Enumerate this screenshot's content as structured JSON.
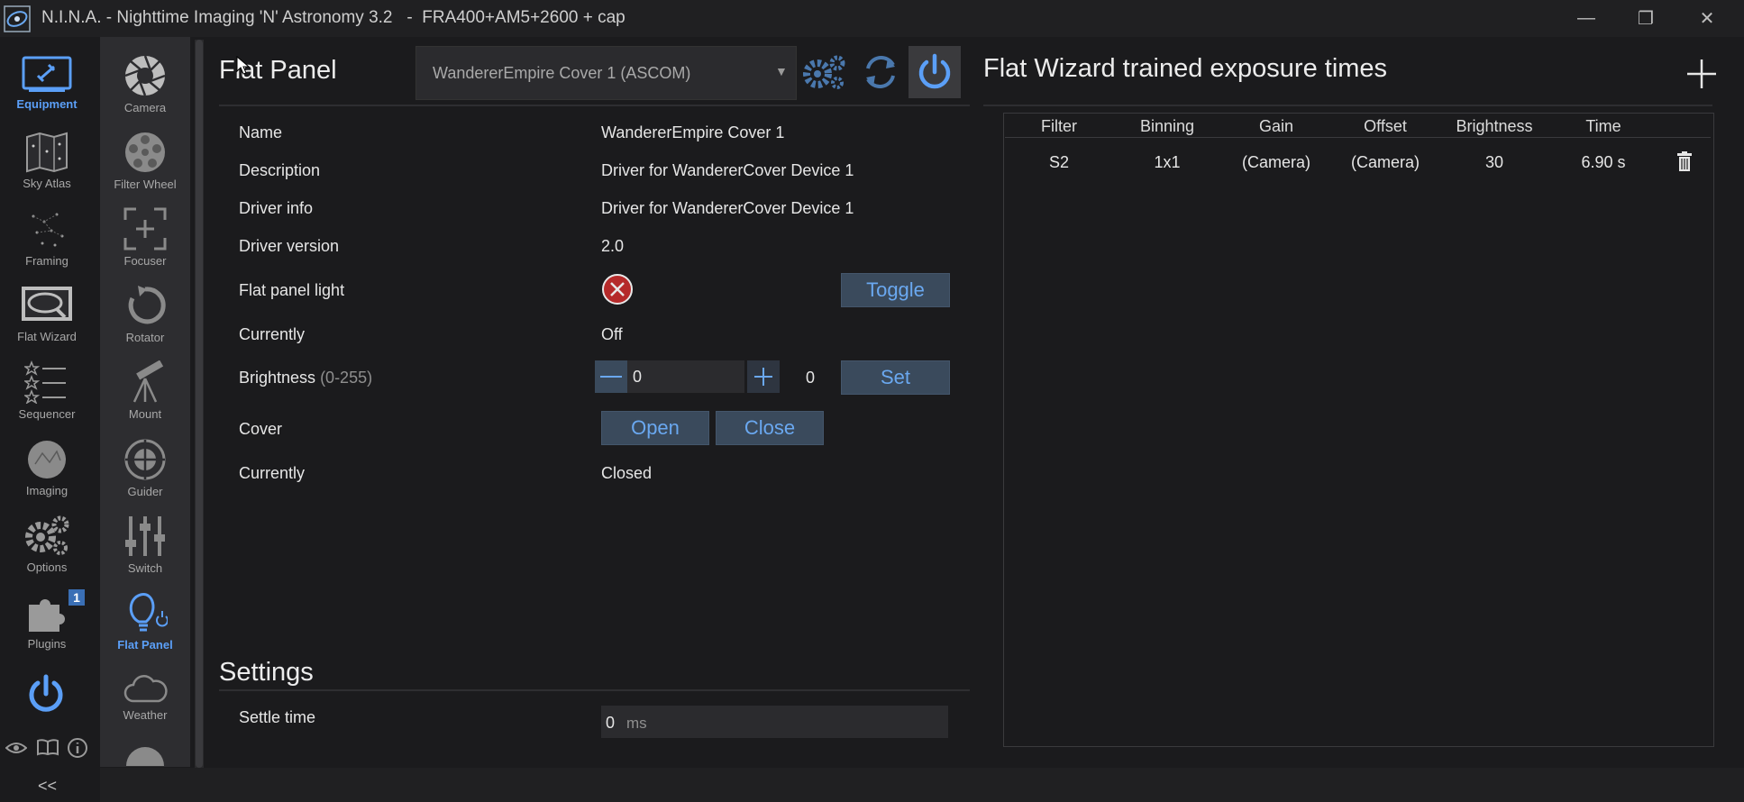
{
  "window": {
    "title": "N.I.N.A. - Nighttime Imaging 'N' Astronomy 3.2   -  FRA400+AM5+2600 + cap",
    "minimize": "—",
    "maximize": "❐",
    "close": "✕"
  },
  "nav_primary": [
    {
      "label": "Equipment",
      "icon": "equipment-icon",
      "active": true
    },
    {
      "label": "Sky Atlas",
      "icon": "sky-atlas-icon"
    },
    {
      "label": "Framing",
      "icon": "framing-icon"
    },
    {
      "label": "Flat Wizard",
      "icon": "flat-wizard-icon"
    },
    {
      "label": "Sequencer",
      "icon": "sequencer-icon"
    },
    {
      "label": "Imaging",
      "icon": "imaging-icon"
    },
    {
      "label": "Options",
      "icon": "options-icon"
    },
    {
      "label": "Plugins",
      "icon": "plugins-icon",
      "badge": "1"
    }
  ],
  "nav_secondary": [
    {
      "label": "Camera",
      "icon": "camera-icon"
    },
    {
      "label": "Filter Wheel",
      "icon": "filter-wheel-icon"
    },
    {
      "label": "Focuser",
      "icon": "focuser-icon"
    },
    {
      "label": "Rotator",
      "icon": "rotator-icon"
    },
    {
      "label": "Mount",
      "icon": "mount-icon"
    },
    {
      "label": "Guider",
      "icon": "guider-icon"
    },
    {
      "label": "Switch",
      "icon": "switch-icon"
    },
    {
      "label": "Flat Panel",
      "icon": "flat-panel-icon",
      "active": true
    },
    {
      "label": "Weather",
      "icon": "weather-icon"
    }
  ],
  "collapse_label": "<<",
  "flat_panel": {
    "title": "Flat Panel",
    "device": "WandererEmpire Cover 1 (ASCOM)",
    "rows": {
      "name_label": "Name",
      "name_value": "WandererEmpire Cover 1",
      "description_label": "Description",
      "description_value": "Driver for WandererCover Device 1",
      "driver_info_label": "Driver info",
      "driver_info_value": "Driver for WandererCover Device 1",
      "driver_version_label": "Driver version",
      "driver_version_value": "2.0",
      "light_label": "Flat panel light",
      "toggle_label": "Toggle",
      "currently_label": "Currently",
      "light_state": "Off",
      "brightness_label": "Brightness",
      "brightness_range": "(0-255)",
      "brightness_input": "0",
      "brightness_current": "0",
      "set_label": "Set",
      "cover_label": "Cover",
      "open_label": "Open",
      "close_label": "Close",
      "cover_currently_label": "Currently",
      "cover_state": "Closed"
    }
  },
  "settings": {
    "title": "Settings",
    "settle_label": "Settle time",
    "settle_value": "0",
    "settle_unit": "ms"
  },
  "flat_wizard": {
    "title": "Flat Wizard trained exposure times",
    "add_label": "+",
    "columns": [
      "Filter",
      "Binning",
      "Gain",
      "Offset",
      "Brightness",
      "Time"
    ],
    "rows": [
      [
        "S2",
        "1x1",
        "(Camera)",
        "(Camera)",
        "30",
        "6.90 s"
      ]
    ]
  },
  "colors": {
    "accent": "#5b9ff7",
    "error": "#b52a2a"
  }
}
